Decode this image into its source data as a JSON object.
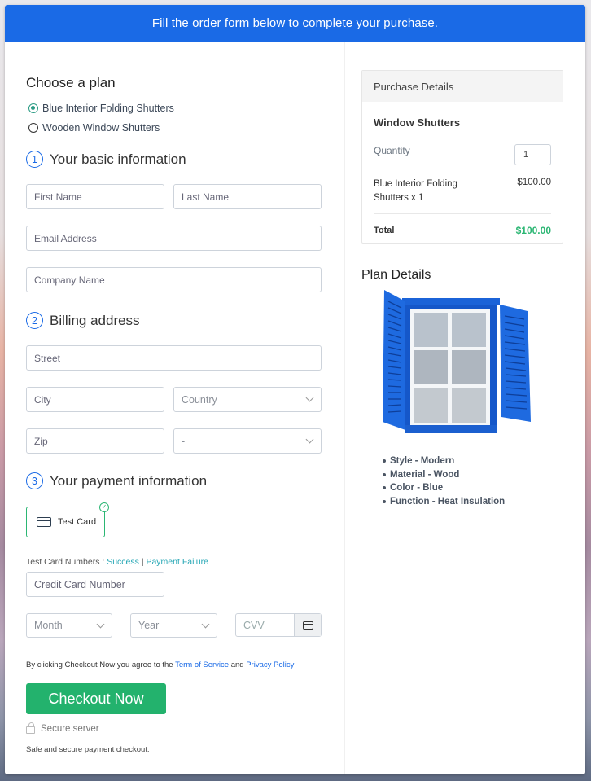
{
  "banner": {
    "text": "Fill the order form below to complete your purchase."
  },
  "plan": {
    "heading": "Choose a plan",
    "options": [
      {
        "label": "Blue Interior Folding Shutters",
        "selected": true
      },
      {
        "label": "Wooden Window Shutters",
        "selected": false
      }
    ]
  },
  "basic_info": {
    "step": "1",
    "heading": "Your basic information",
    "first_name_placeholder": "First Name",
    "last_name_placeholder": "Last Name",
    "email_placeholder": "Email Address",
    "company_placeholder": "Company Name"
  },
  "billing": {
    "step": "2",
    "heading": "Billing address",
    "street_placeholder": "Street",
    "city_placeholder": "City",
    "country_placeholder": "Country",
    "zip_placeholder": "Zip",
    "state_placeholder": "-"
  },
  "payment": {
    "step": "3",
    "heading": "Your payment information",
    "card_option": "Test Card",
    "test_numbers_label": "Test Card Numbers :",
    "success_link": "Success",
    "separator": "|",
    "failure_link": "Payment Failure",
    "card_number_placeholder": "Credit Card Number",
    "month_placeholder": "Month",
    "year_placeholder": "Year",
    "cvv_placeholder": "CVV"
  },
  "terms": {
    "prefix": "By clicking Checkout Now you agree to the",
    "tos_link": "Term of Service",
    "and": "and",
    "privacy_link": "Privacy Policy"
  },
  "checkout_button": "Checkout Now",
  "secure_label": "Secure server",
  "safe_text": "Safe and secure payment checkout.",
  "purchase": {
    "heading": "Purchase Details",
    "product": "Window Shutters",
    "quantity_label": "Quantity",
    "quantity_value": "1",
    "item_name": "Blue Interior Folding Shutters x 1",
    "item_price": "$100.00",
    "total_label": "Total",
    "total_value": "$100.00"
  },
  "plan_details": {
    "heading": "Plan Details",
    "features": [
      "Style - Modern",
      "Material - Wood",
      "Color - Blue",
      "Function - Heat Insulation"
    ]
  },
  "colors": {
    "brand_blue": "#1a6ae6",
    "success_green": "#23b26d",
    "link_teal": "#26a7b5"
  }
}
